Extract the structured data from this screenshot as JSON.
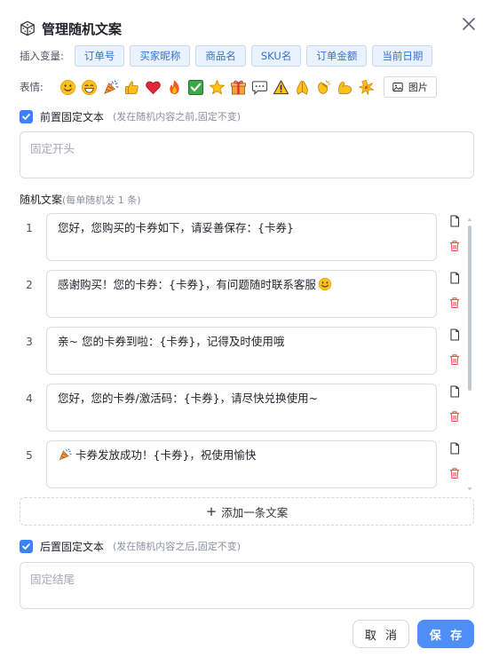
{
  "dialog": {
    "title": "管理随机文案",
    "icons": {
      "title": "dice-icon",
      "close": "close-icon"
    }
  },
  "insert_vars": {
    "label": "插入变量:",
    "tags": [
      "订单号",
      "买家昵称",
      "商品名",
      "SKU名",
      "订单金额",
      "当前日期"
    ]
  },
  "emoji_bar": {
    "label": "表情:",
    "emojis": [
      "smiling-face",
      "grinning-face",
      "party-popper",
      "thumbs-up",
      "red-heart",
      "fire",
      "check-mark-button",
      "star",
      "wrapped-gift",
      "speech-bubble",
      "warning",
      "folded-hands",
      "clapping-hands",
      "flexed-biceps",
      "sparkles"
    ],
    "image_button": "图片"
  },
  "prefix": {
    "checked": true,
    "label": "前置固定文本",
    "hint": "(发在随机内容之前,固定不变)",
    "placeholder": "固定开头"
  },
  "random": {
    "title": "随机文案",
    "subtitle": "(每单随机发 1 条)",
    "items": [
      {
        "index": "1",
        "text": "您好，您购买的卡券如下，请妥善保存：{卡券}"
      },
      {
        "index": "2",
        "text": "感谢购买！您的卡券：{卡券}，有问题随时联系客服",
        "emoji_after": "smiling-face"
      },
      {
        "index": "3",
        "text": "亲~ 您的卡券到啦：{卡券}，记得及时使用哦"
      },
      {
        "index": "4",
        "text": "您好，您的卡券/激活码：{卡券}，请尽快兑换使用~"
      },
      {
        "index": "5",
        "text": "卡券发放成功！{卡券}，祝使用愉快",
        "emoji_before": "party-popper"
      }
    ],
    "add_label": "添加一条文案"
  },
  "suffix": {
    "checked": true,
    "label": "后置固定文本",
    "hint": "(发在随机内容之后,固定不变)",
    "placeholder": "固定结尾"
  },
  "footer": {
    "cancel": "取 消",
    "save": "保 存"
  },
  "colors": {
    "primary": "#4f8ef7",
    "tag_bg": "#eaf2fd",
    "tag_text": "#3570d8",
    "delete": "#e84d4d"
  }
}
